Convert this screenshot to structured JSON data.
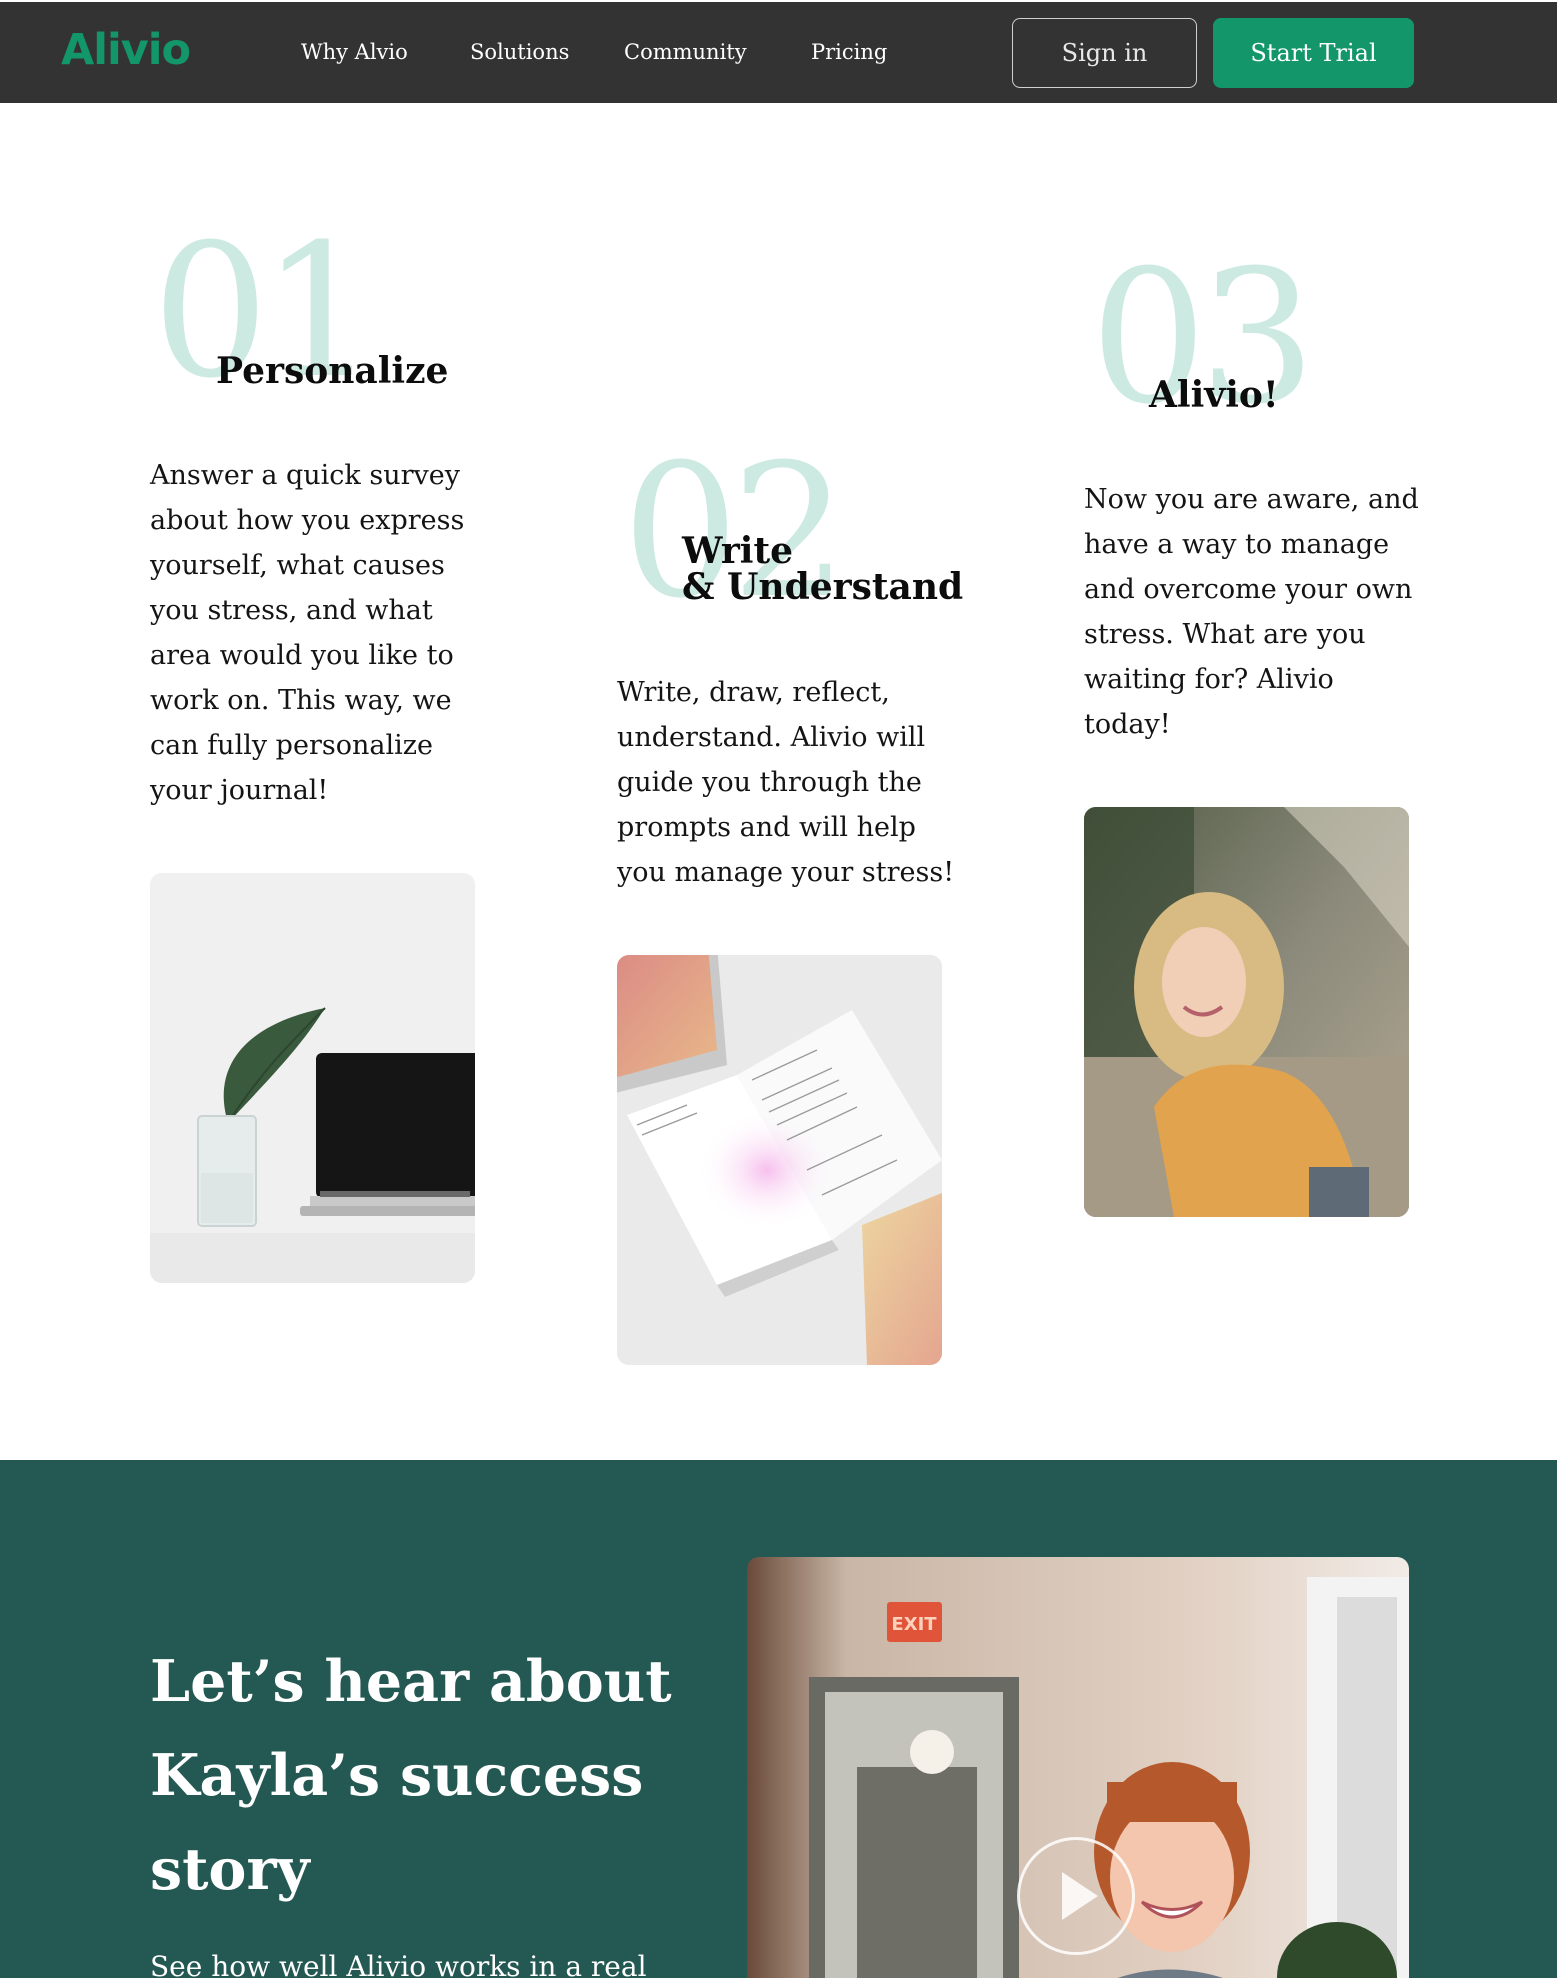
{
  "nav": {
    "logo": "Alivio",
    "links": [
      "Why Alvio",
      "Solutions",
      "Community",
      "Pricing"
    ],
    "signin_label": "Sign in",
    "trial_label": "Start Trial"
  },
  "steps": [
    {
      "number": "01",
      "title_line1": "Personalize",
      "title_line2": "",
      "text": "Answer a quick survey about how you express yourself, what causes you stress, and what area would you like to work on. This way, we can fully personalize your journal!"
    },
    {
      "number": "02",
      "title_line1": "Write",
      "title_line2": "& Understand",
      "text": "Write, draw, reflect, understand. Alivio will guide you through the prompts and will help you manage your stress!"
    },
    {
      "number": "03",
      "title_line1": "Alivio!",
      "title_line2": "",
      "text": "Now you are aware, and have a way to manage and overcome your own stress. What are you waiting for? Alivio today!"
    }
  ],
  "story": {
    "title": "Let’s hear about Kayla’s success story",
    "subtitle": "See how well Alivio works in a real",
    "exit_sign": "EXIT"
  },
  "icons": {
    "play": "play-icon"
  },
  "colors": {
    "brand": "#12966a",
    "nav_bg": "#333333",
    "step_number": "#cdeae2",
    "story_bg": "#245852"
  }
}
